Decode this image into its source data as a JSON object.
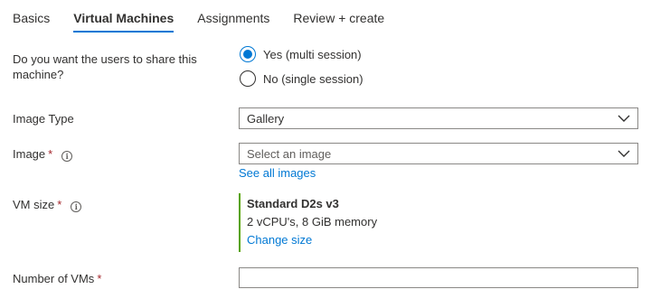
{
  "tabs": [
    {
      "label": "Basics",
      "active": false
    },
    {
      "label": "Virtual Machines",
      "active": true
    },
    {
      "label": "Assignments",
      "active": false
    },
    {
      "label": "Review + create",
      "active": false
    }
  ],
  "share": {
    "question": "Do you want the users to share this machine?",
    "options": [
      {
        "label": "Yes (multi session)",
        "selected": true
      },
      {
        "label": "No (single session)",
        "selected": false
      }
    ]
  },
  "image_type": {
    "label": "Image Type",
    "value": "Gallery"
  },
  "image": {
    "label": "Image",
    "required_mark": "*",
    "info_glyph": "i",
    "placeholder": "Select an image",
    "link": "See all images"
  },
  "vm_size": {
    "label": "VM size",
    "required_mark": "*",
    "info_glyph": "i",
    "name": "Standard D2s v3",
    "details": "2 vCPU's, 8 GiB memory",
    "link": "Change size"
  },
  "num_vms": {
    "label": "Number of VMs",
    "required_mark": "*",
    "value": ""
  },
  "colors": {
    "accent": "#0078d4",
    "required": "#a4262c",
    "success_bar": "#57a300"
  },
  "icons": [
    "info-icon",
    "chevron-down-icon",
    "radio-selected-icon",
    "radio-unselected-icon"
  ]
}
